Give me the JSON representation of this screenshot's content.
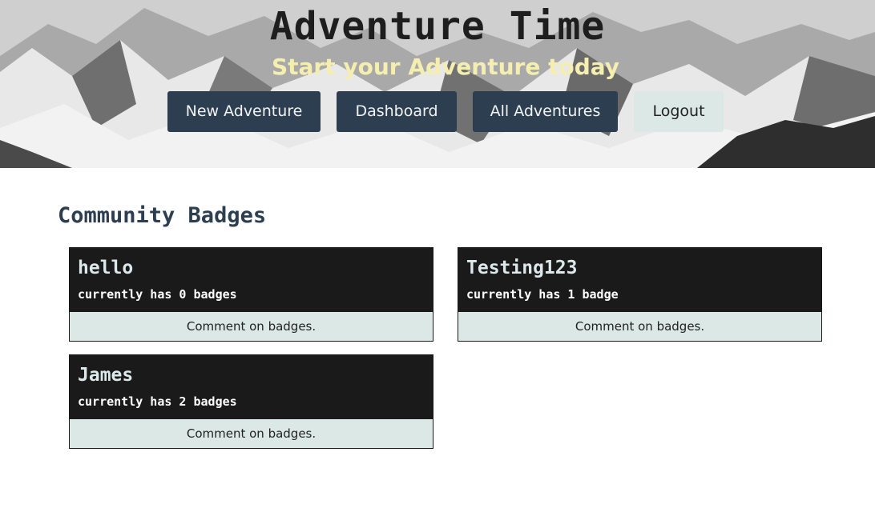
{
  "header": {
    "title": "Adventure Time",
    "tagline": "Start your Adventure today"
  },
  "nav": {
    "new_adventure": "New Adventure",
    "dashboard": "Dashboard",
    "all_adventures": "All Adventures",
    "logout": "Logout"
  },
  "main": {
    "section_title": "Community Badges",
    "users": [
      {
        "name": "hello",
        "badges": "currently has 0 badges",
        "action": "Comment on badges."
      },
      {
        "name": "Testing123",
        "badges": "currently has 1 badge",
        "action": "Comment on badges."
      },
      {
        "name": "James",
        "badges": "currently has 2 badges",
        "action": "Comment on badges."
      }
    ]
  },
  "colors": {
    "nav_dark": "#2c3e50",
    "nav_light": "#dbe8e6",
    "tagline": "#f4efb0",
    "card_bg": "#1a1a1a",
    "card_footer": "#dbe8e6"
  }
}
